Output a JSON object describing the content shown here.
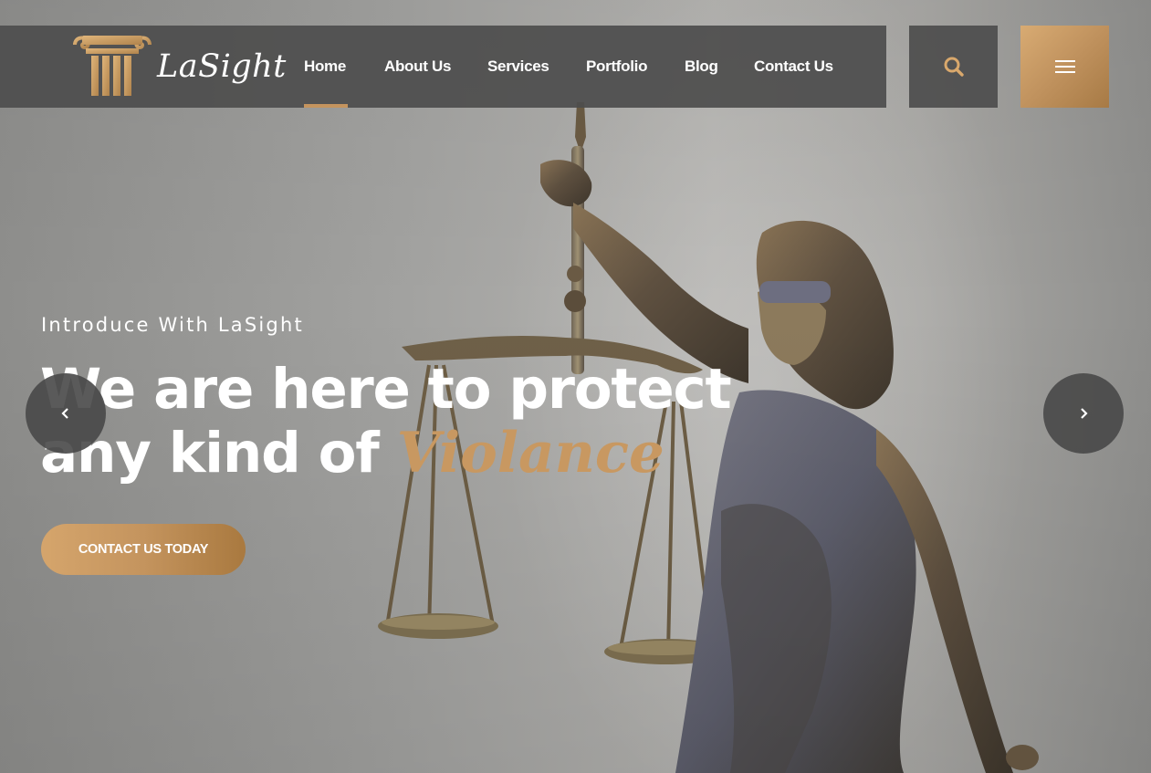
{
  "brand": {
    "name": "LaSight",
    "accent_color": "#c4945e"
  },
  "nav": {
    "items": [
      {
        "label": "Home",
        "active": true
      },
      {
        "label": "About Us",
        "active": false
      },
      {
        "label": "Services",
        "active": false
      },
      {
        "label": "Portfolio",
        "active": false
      },
      {
        "label": "Blog",
        "active": false
      },
      {
        "label": "Contact Us",
        "active": false
      }
    ],
    "search_icon": "search-icon",
    "menu_icon": "hamburger-menu-icon"
  },
  "hero": {
    "intro": "Introduce With LaSight",
    "headline_line1": "We are here to protect",
    "headline_line2": "any kind of ",
    "headline_accent": "Violance",
    "cta_label": "CONTACT US TODAY",
    "prev_icon": "chevron-left-icon",
    "next_icon": "chevron-right-icon"
  }
}
